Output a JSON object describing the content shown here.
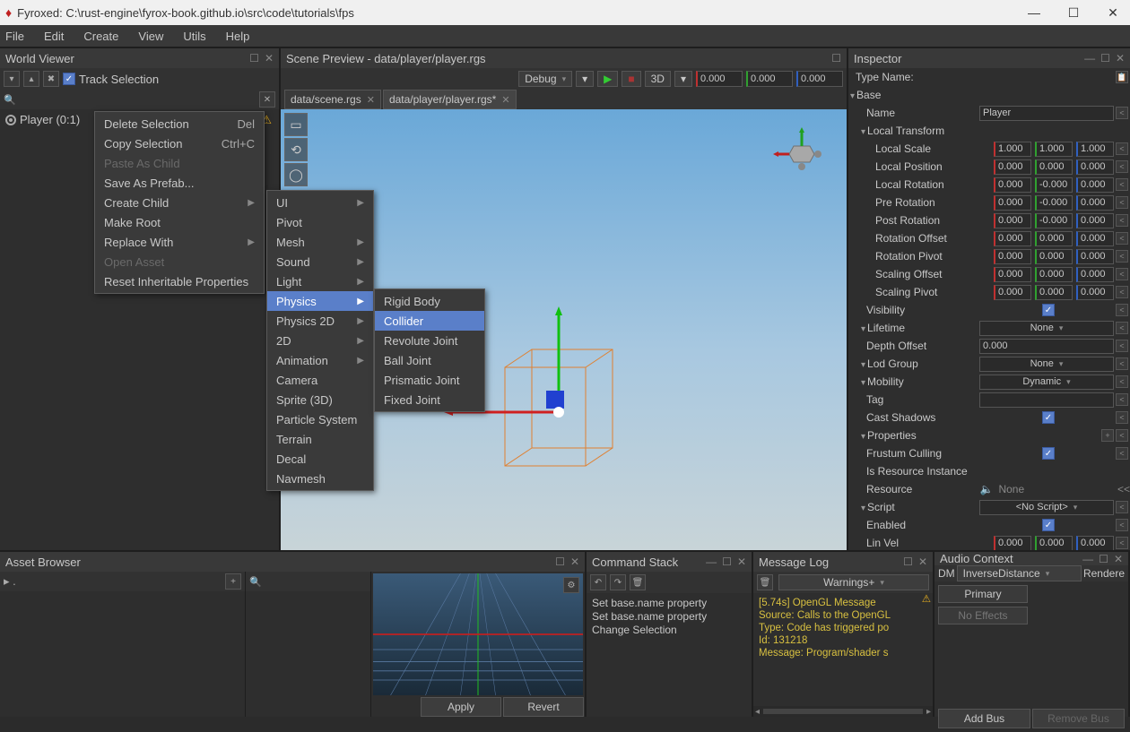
{
  "window": {
    "title": "Fyroxed: C:\\rust-engine\\fyrox-book.github.io\\src\\code\\tutorials\\fps"
  },
  "menubar": [
    "File",
    "Edit",
    "Create",
    "View",
    "Utils",
    "Help"
  ],
  "world_viewer": {
    "title": "World Viewer",
    "track_selection": "Track Selection",
    "tree": [
      {
        "label": "Player (0:1)"
      }
    ]
  },
  "ctx_main": [
    {
      "label": "Delete Selection",
      "shortcut": "Del"
    },
    {
      "label": "Copy Selection",
      "shortcut": "Ctrl+C"
    },
    {
      "label": "Paste As Child",
      "disabled": true
    },
    {
      "label": "Save As Prefab..."
    },
    {
      "label": "Create Child",
      "sub": true
    },
    {
      "label": "Make Root"
    },
    {
      "label": "Replace With",
      "sub": true
    },
    {
      "label": "Open Asset",
      "disabled": true
    },
    {
      "label": "Reset Inheritable Properties"
    }
  ],
  "ctx_create": [
    {
      "label": "UI",
      "sub": true
    },
    {
      "label": "Pivot"
    },
    {
      "label": "Mesh",
      "sub": true
    },
    {
      "label": "Sound",
      "sub": true
    },
    {
      "label": "Light",
      "sub": true
    },
    {
      "label": "Physics",
      "sub": true,
      "hover": true
    },
    {
      "label": "Physics 2D",
      "sub": true
    },
    {
      "label": "2D",
      "sub": true
    },
    {
      "label": "Animation",
      "sub": true
    },
    {
      "label": "Camera"
    },
    {
      "label": "Sprite (3D)"
    },
    {
      "label": "Particle System"
    },
    {
      "label": "Terrain"
    },
    {
      "label": "Decal"
    },
    {
      "label": "Navmesh"
    }
  ],
  "ctx_physics": [
    {
      "label": "Rigid Body"
    },
    {
      "label": "Collider",
      "hover": true
    },
    {
      "label": "Revolute Joint"
    },
    {
      "label": "Ball Joint"
    },
    {
      "label": "Prismatic Joint"
    },
    {
      "label": "Fixed Joint"
    }
  ],
  "scene": {
    "title": "Scene Preview - data/player/player.rgs",
    "config": "Debug",
    "mode3d": "3D",
    "coords": {
      "x": "0.000",
      "y": "0.000",
      "z": "0.000"
    },
    "tabs": [
      {
        "label": "data/scene.rgs",
        "active": false
      },
      {
        "label": "data/player/player.rgs*",
        "active": true
      }
    ]
  },
  "inspector": {
    "title": "Inspector",
    "type_name_lbl": "Type Name:",
    "base_lbl": "Base",
    "name_lbl": "Name",
    "name_val": "Player",
    "local_transform_lbl": "Local Transform",
    "rows3": [
      {
        "label": "Local Scale",
        "x": "1.000",
        "y": "1.000",
        "z": "1.000"
      },
      {
        "label": "Local Position",
        "x": "0.000",
        "y": "0.000",
        "z": "0.000"
      },
      {
        "label": "Local Rotation",
        "x": "0.000",
        "y": "-0.000",
        "z": "0.000"
      },
      {
        "label": "Pre Rotation",
        "x": "0.000",
        "y": "-0.000",
        "z": "0.000"
      },
      {
        "label": "Post Rotation",
        "x": "0.000",
        "y": "-0.000",
        "z": "0.000"
      },
      {
        "label": "Rotation Offset",
        "x": "0.000",
        "y": "0.000",
        "z": "0.000"
      },
      {
        "label": "Rotation Pivot",
        "x": "0.000",
        "y": "0.000",
        "z": "0.000"
      },
      {
        "label": "Scaling Offset",
        "x": "0.000",
        "y": "0.000",
        "z": "0.000"
      },
      {
        "label": "Scaling Pivot",
        "x": "0.000",
        "y": "0.000",
        "z": "0.000"
      }
    ],
    "visibility_lbl": "Visibility",
    "lifetime_lbl": "Lifetime",
    "lifetime_val": "None",
    "depth_offset_lbl": "Depth Offset",
    "depth_offset_val": "0.000",
    "lod_lbl": "Lod Group",
    "lod_val": "None",
    "mobility_lbl": "Mobility",
    "mobility_val": "Dynamic",
    "tag_lbl": "Tag",
    "cast_lbl": "Cast Shadows",
    "props_lbl": "Properties",
    "frustum_lbl": "Frustum Culling",
    "resinst_lbl": "Is Resource Instance",
    "resource_lbl": "Resource",
    "resource_val": "None",
    "script_lbl": "Script",
    "script_val": "<No Script>",
    "enabled_lbl": "Enabled",
    "linvel_lbl": "Lin Vel",
    "linvel": {
      "x": "0.000",
      "y": "0.000",
      "z": "0.000"
    }
  },
  "asset": {
    "title": "Asset Browser",
    "apply": "Apply",
    "revert": "Revert"
  },
  "cmd": {
    "title": "Command Stack",
    "items": [
      "Set base.name property",
      "Set base.name property",
      "Change Selection"
    ]
  },
  "msglog": {
    "title": "Message Log",
    "filter": "Warnings+",
    "lines": [
      "[5.74s] OpenGL Message",
      "Source: Calls to the OpenGL",
      "Type: Code has triggered po",
      "Id: 131218",
      "Message: Program/shader s"
    ]
  },
  "audio": {
    "title": "Audio Context",
    "dm_lbl": "DM",
    "dm_val": "InverseDistance",
    "render_lbl": "Rendere",
    "primary": "Primary",
    "noeff": "No Effects",
    "add": "Add Bus",
    "remove": "Remove Bus"
  }
}
